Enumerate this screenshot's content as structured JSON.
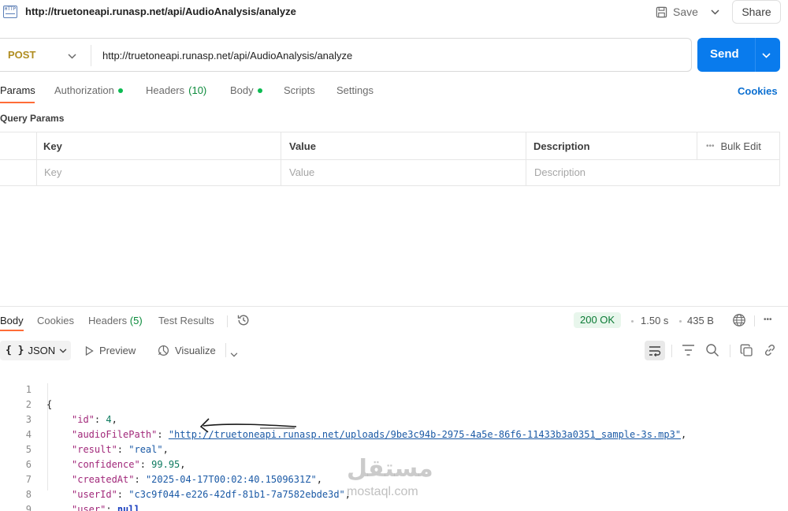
{
  "header": {
    "badge": "HTTP",
    "title": "http://truetoneapi.runasp.net/api/AudioAnalysis/analyze",
    "save_label": "Save",
    "share_label": "Share"
  },
  "request": {
    "method": "POST",
    "url": "http://truetoneapi.runasp.net/api/AudioAnalysis/analyze",
    "send_label": "Send"
  },
  "tabs": [
    {
      "label": "Params"
    },
    {
      "label": "Authorization"
    },
    {
      "label": "Headers",
      "count": "(10)"
    },
    {
      "label": "Body"
    },
    {
      "label": "Scripts"
    },
    {
      "label": "Settings"
    }
  ],
  "cookies_label": "Cookies",
  "query_params": {
    "title": "Query Params",
    "columns": [
      "Key",
      "Value",
      "Description"
    ],
    "bulk_edit": "Bulk Edit",
    "more": "•••",
    "placeholders": [
      "Key",
      "Value",
      "Description"
    ]
  },
  "response": {
    "tabs": [
      {
        "label": "Body"
      },
      {
        "label": "Cookies"
      },
      {
        "label": "Headers",
        "count": "(5)"
      },
      {
        "label": "Test Results"
      }
    ],
    "status": "200 OK",
    "time": "1.50 s",
    "size": "435 B",
    "more": "•••",
    "format": "JSON",
    "format_braces": "{ }",
    "preview_label": "Preview",
    "visualize_label": "Visualize"
  },
  "code_lines": [
    {
      "num": "1"
    },
    {
      "num": "2"
    },
    {
      "num": "3"
    },
    {
      "num": "4"
    },
    {
      "num": "5"
    },
    {
      "num": "6"
    },
    {
      "num": "7"
    },
    {
      "num": "8"
    },
    {
      "num": "9"
    }
  ],
  "json_body": {
    "open": "{",
    "close": "}",
    "id_key": "\"id\"",
    "id_val": "4",
    "path_key": "\"audioFilePath\"",
    "path_val": "\"http://truetoneapi.runasp.net/uploads/9be3c94b-2975-4a5e-86f6-11433b3a0351_sample-3s.mp3\"",
    "result_key": "\"result\"",
    "result_val": "\"real\"",
    "conf_key": "\"confidence\"",
    "conf_val": "99.95",
    "created_key": "\"createdAt\"",
    "created_val": "\"2025-04-17T00:02:40.1509631Z\"",
    "user_id_key": "\"userId\"",
    "user_id_val": "\"c3c9f044-e226-42df-81b1-7a7582ebde3d\"",
    "user_key": "\"user\"",
    "user_val": "null"
  },
  "watermark": {
    "arabic": "مستقل",
    "latin": "mostaql.com"
  },
  "colors": {
    "accent": "#ff6c37",
    "send": "#097bed",
    "method": "#b08d20",
    "status_ok": "#0a7a34",
    "link": "#0b6fd1"
  }
}
